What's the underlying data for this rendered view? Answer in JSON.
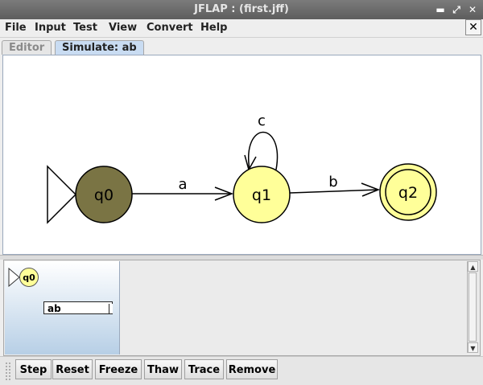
{
  "window": {
    "title": "JFLAP : (first.jff)"
  },
  "menubar": [
    "File",
    "Input",
    "Test",
    "View",
    "Convert",
    "Help"
  ],
  "close_glyph": "✕",
  "tabs": {
    "editor": "Editor",
    "simulate": "Simulate: ab"
  },
  "automaton": {
    "states": [
      {
        "id": "q0",
        "label": "q0",
        "initial": true,
        "final": false,
        "color": "#7a7444"
      },
      {
        "id": "q1",
        "label": "q1",
        "initial": false,
        "final": false,
        "color": "#ffff99"
      },
      {
        "id": "q2",
        "label": "q2",
        "initial": false,
        "final": true,
        "color": "#ffff99"
      }
    ],
    "transitions": [
      {
        "from": "q0",
        "to": "q1",
        "label": "a"
      },
      {
        "from": "q1",
        "to": "q1",
        "label": "c"
      },
      {
        "from": "q1",
        "to": "q2",
        "label": "b"
      }
    ]
  },
  "configuration": {
    "state": "q0",
    "input": "ab"
  },
  "toolbar": [
    "Step",
    "Reset",
    "Freeze",
    "Thaw",
    "Trace",
    "Remove"
  ],
  "colors": {
    "accent_tab": "#c9dcf2",
    "current_state": "#7a7444",
    "state_fill": "#ffff99"
  }
}
